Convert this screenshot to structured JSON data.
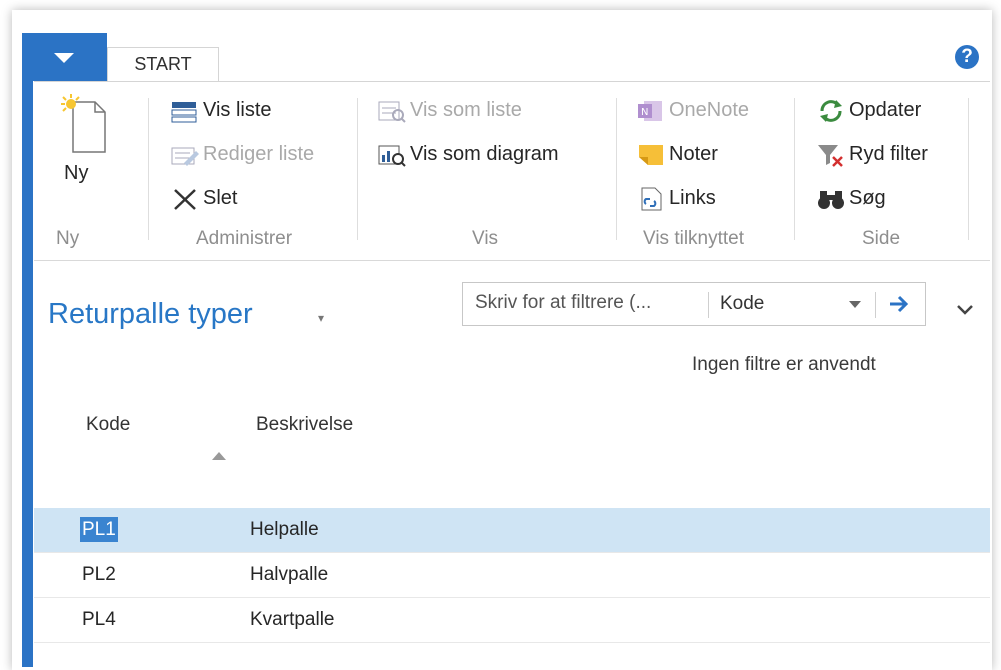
{
  "tabs": {
    "menu_icon": "chevron-down-icon",
    "start": "START",
    "help": "?"
  },
  "ribbon": {
    "new": {
      "label": "Ny"
    },
    "administrer": {
      "vis_liste": "Vis liste",
      "rediger_liste": "Rediger liste",
      "slet": "Slet"
    },
    "vis": {
      "vis_som_liste": "Vis som liste",
      "vis_som_diagram": "Vis som diagram"
    },
    "tilknyttet": {
      "onenote": "OneNote",
      "noter": "Noter",
      "links": "Links"
    },
    "side": {
      "opdater": "Opdater",
      "ryd_filter": "Ryd filter",
      "sog": "Søg"
    },
    "groups": {
      "ny": "Ny",
      "administrer": "Administrer",
      "vis": "Vis",
      "vis_tilknyttet": "Vis tilknyttet",
      "side": "Side"
    }
  },
  "page": {
    "title": "Returpalle typer",
    "title_caret": "▾"
  },
  "filter": {
    "placeholder": "Skriv for at filtrere (...",
    "field": "Kode",
    "status": "Ingen filtre er anvendt"
  },
  "table": {
    "headers": {
      "code": "Kode",
      "description": "Beskrivelse"
    },
    "rows": [
      {
        "code": "PL1",
        "description": "Helpalle",
        "selected": true
      },
      {
        "code": "PL2",
        "description": "Halvpalle",
        "selected": false
      },
      {
        "code": "PL4",
        "description": "Kvartpalle",
        "selected": false
      }
    ]
  },
  "colors": {
    "accent": "#2b73c5",
    "title": "#2877c6",
    "selected_row": "#cfe4f4",
    "selected_text": "#3a84d0"
  }
}
